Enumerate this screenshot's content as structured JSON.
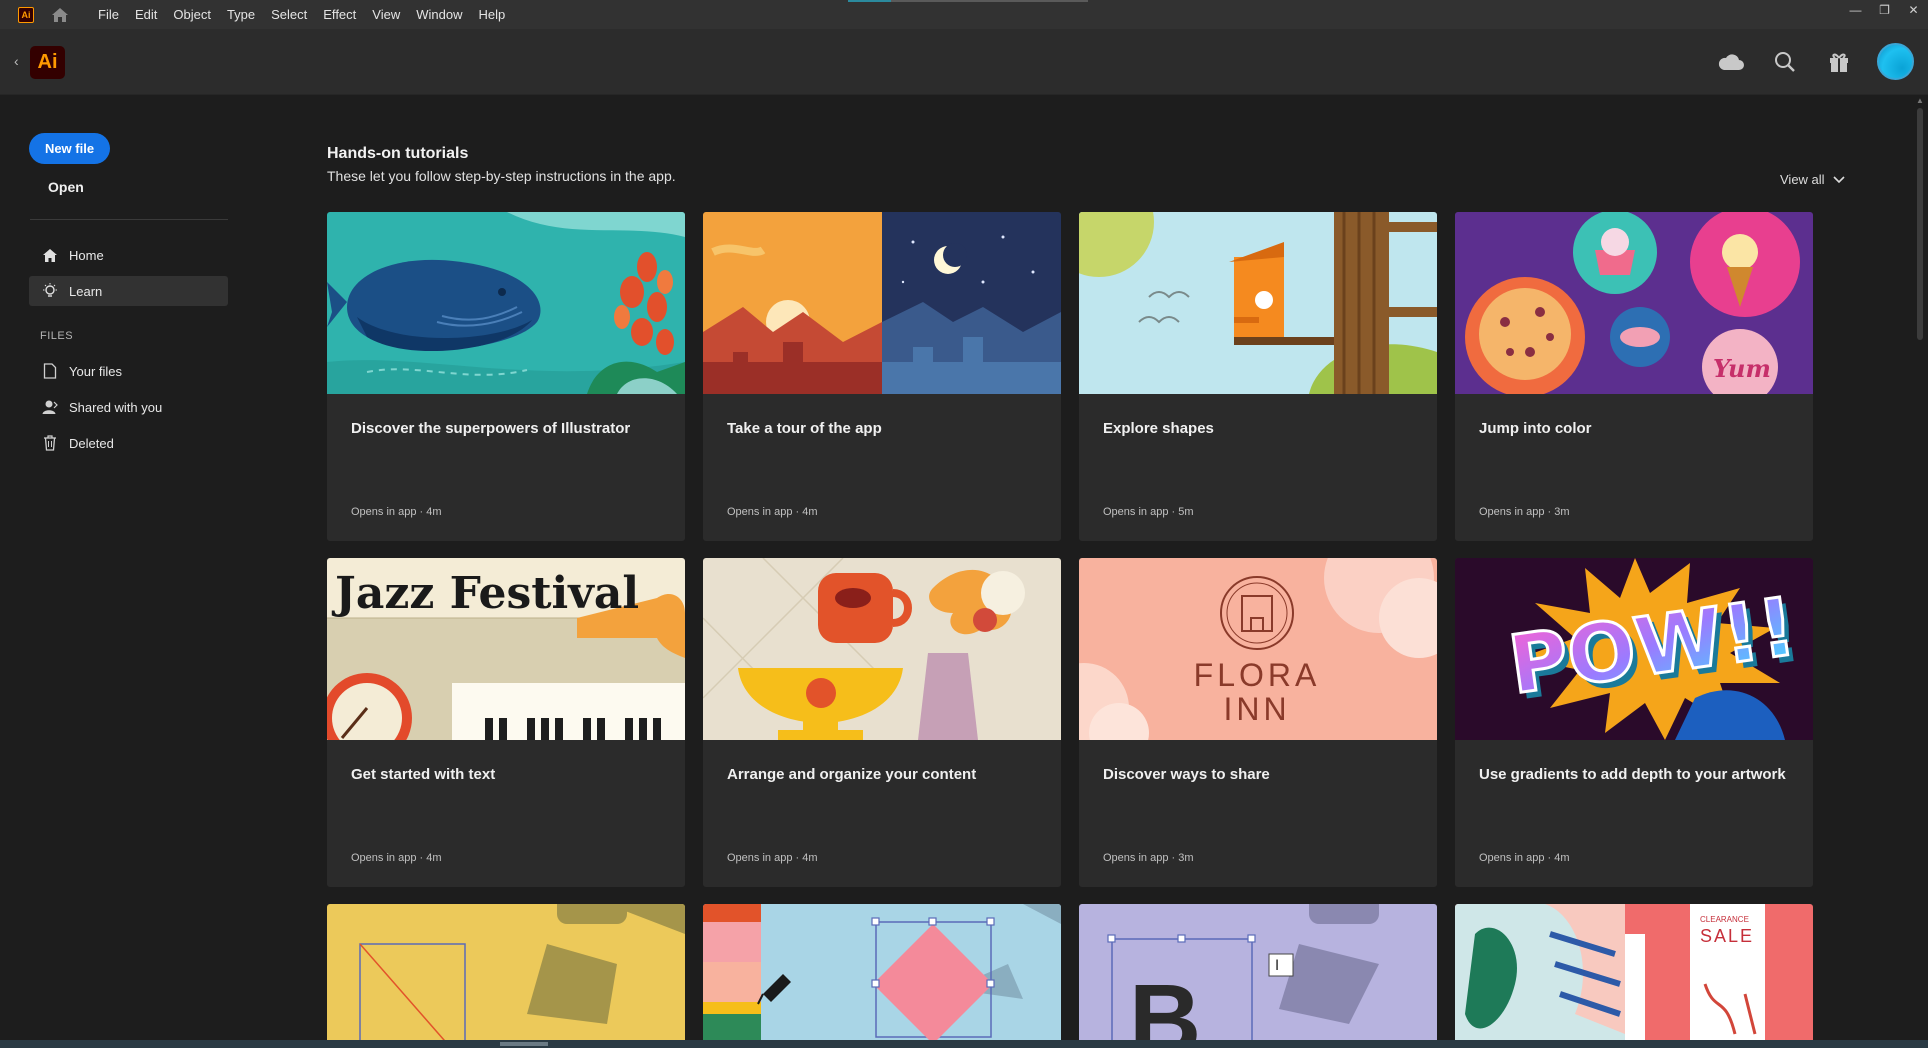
{
  "app": {
    "mini_logo": "Ai",
    "logo": "Ai",
    "menus": [
      "File",
      "Edit",
      "Object",
      "Type",
      "Select",
      "Effect",
      "View",
      "Window",
      "Help"
    ],
    "window_controls": [
      "minimize-icon",
      "restore-icon",
      "close-icon"
    ],
    "loading_progress": 0.18
  },
  "header": {
    "icons": [
      "cloud-icon",
      "search-icon",
      "gift-icon",
      "avatar"
    ]
  },
  "sidebar": {
    "new_file": "New file",
    "open": "Open",
    "nav": [
      {
        "label": "Home",
        "icon": "home-icon",
        "active": false
      },
      {
        "label": "Learn",
        "icon": "lightbulb-icon",
        "active": true
      }
    ],
    "files_heading": "FILES",
    "files": [
      {
        "label": "Your files",
        "icon": "file-icon"
      },
      {
        "label": "Shared with you",
        "icon": "shared-user-icon"
      },
      {
        "label": "Deleted",
        "icon": "trash-icon"
      }
    ]
  },
  "section": {
    "title": "Hands-on tutorials",
    "subtitle": "These let you follow step-by-step instructions in the app.",
    "view_all": "View all"
  },
  "cards": [
    {
      "title": "Discover the superpowers of Illustrator",
      "meta": "Opens in app  ·  4m",
      "art": "whale"
    },
    {
      "title": "Take a tour of the app",
      "meta": "Opens in app  ·  4m",
      "art": "daynight"
    },
    {
      "title": "Explore shapes",
      "meta": "Opens in app  ·  5m",
      "art": "birdhouse"
    },
    {
      "title": "Jump into color",
      "meta": "Opens in app  ·  3m",
      "art": "sweets"
    },
    {
      "title": "Get started with text",
      "meta": "Opens in app  ·  4m",
      "art": "jazz",
      "art_text": "Jazz Festival"
    },
    {
      "title": "Arrange and organize your content",
      "meta": "Opens in app  ·  4m",
      "art": "still"
    },
    {
      "title": "Discover ways to share",
      "meta": "Opens in app  ·  3m",
      "art": "flora",
      "art_text": "FLORA INN"
    },
    {
      "title": "Use gradients to add depth to your artwork",
      "meta": "Opens in app  ·  4m",
      "art": "pow",
      "art_text": "POW!!"
    }
  ],
  "partial_cards": [
    {
      "art": "yellow-shapes"
    },
    {
      "art": "blue-diamond"
    },
    {
      "art": "lavender-b",
      "art_text": "B"
    },
    {
      "art": "sale",
      "art_text": "SALE",
      "art_text_2": "CLEARANCE"
    }
  ],
  "colors": {
    "accent": "#1473e6",
    "brand_ai_bg": "#330000",
    "brand_ai_fg": "#ff9a00",
    "background": "#1d1d1d",
    "card": "#2b2b2b"
  }
}
